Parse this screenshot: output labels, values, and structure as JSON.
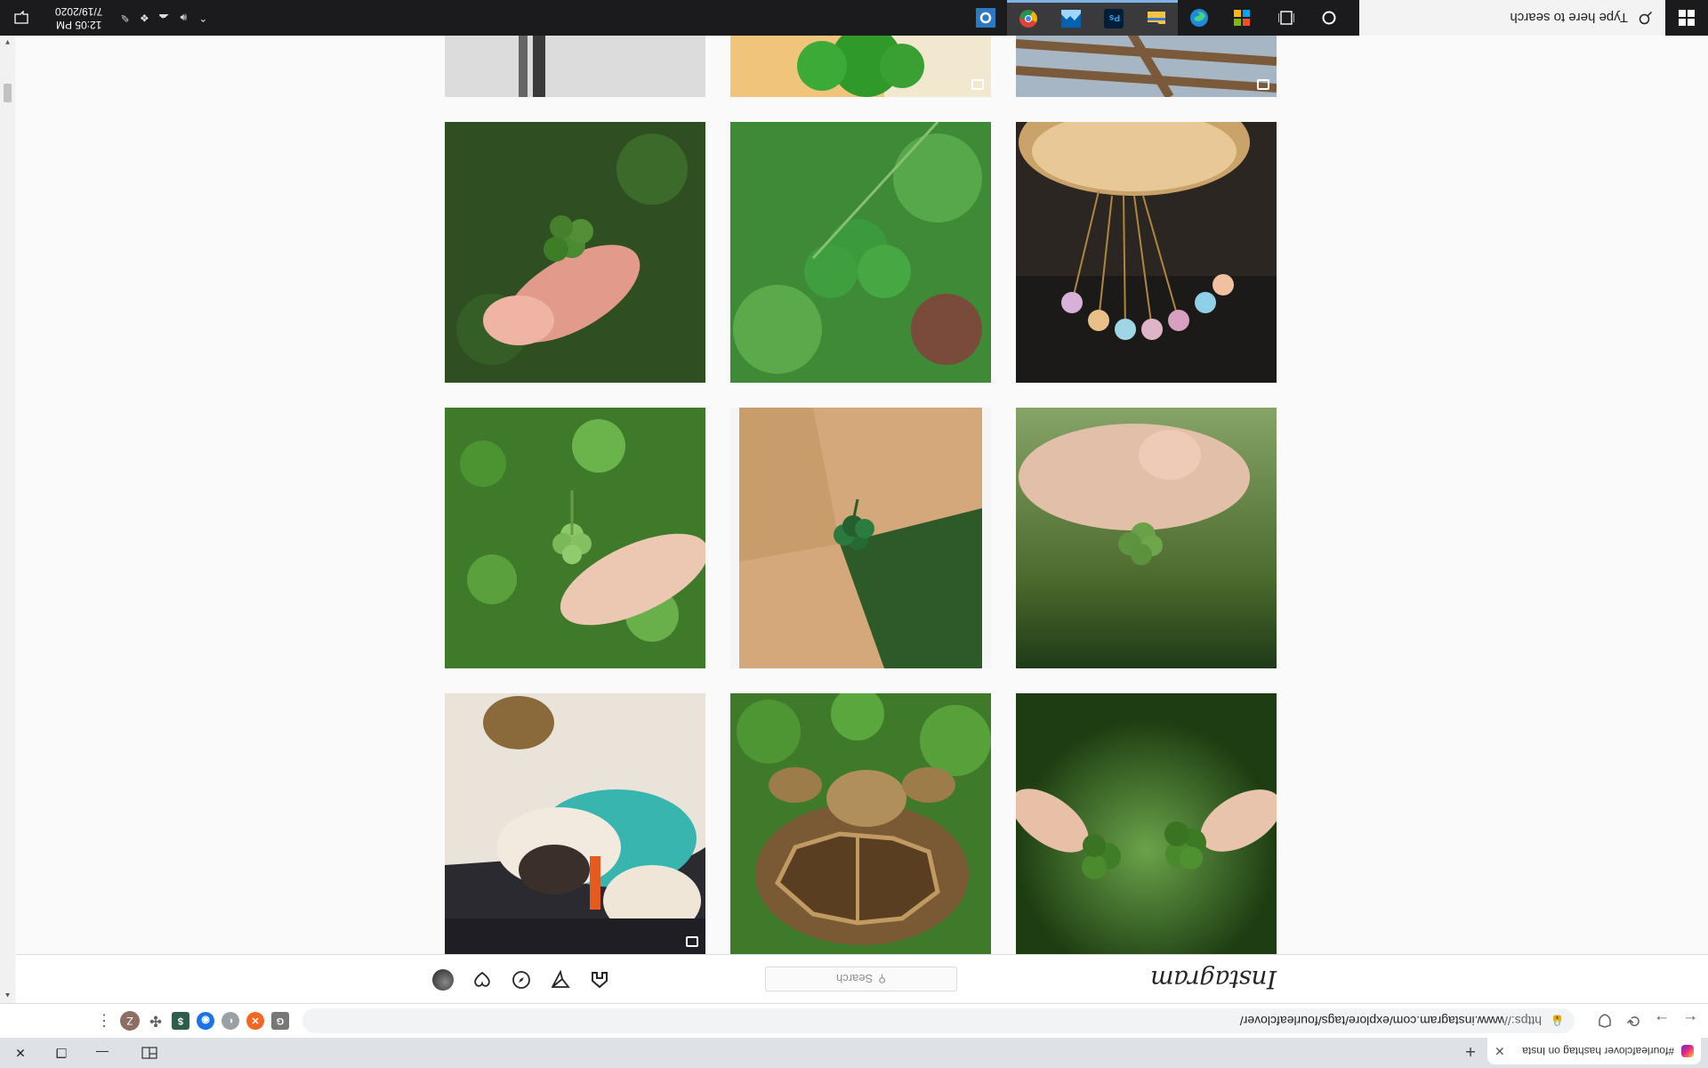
{
  "taskbar": {
    "search_placeholder": "Type here to search",
    "clock_time": "12:05 PM",
    "clock_date": "7/19/2020"
  },
  "browser": {
    "tab_title": "#fourleafclover hashtag on Insta",
    "url_scheme": "https://",
    "url_rest": "www.instagram.com/explore/tags/fourleafclover/",
    "profile_initial": "Z"
  },
  "instagram": {
    "logo_text": "Instagram",
    "search_placeholder": "Search"
  },
  "colors": {
    "taskbar_bg": "#1b1b1d",
    "instagram_border": "#dbdbdb",
    "page_bg": "#fafafa",
    "chrome_tabstrip": "#dee1e6"
  }
}
